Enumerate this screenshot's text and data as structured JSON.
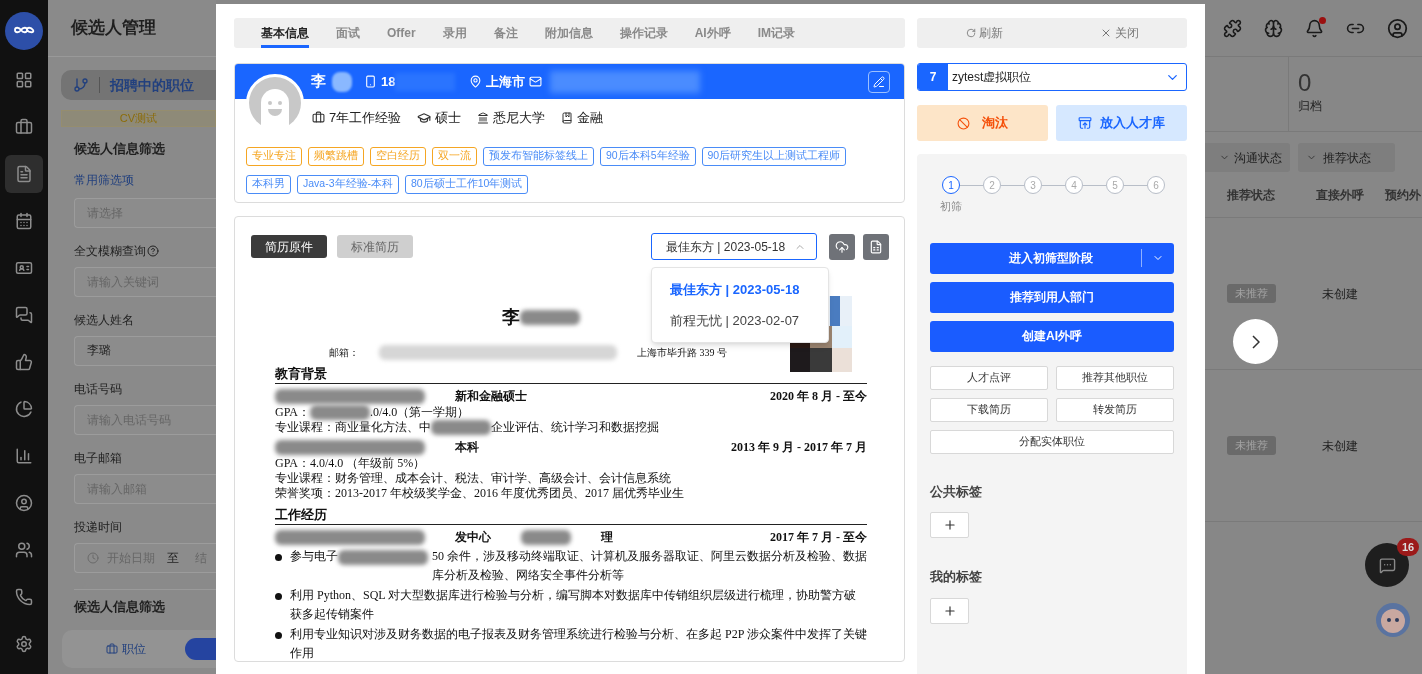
{
  "sidebar": {
    "items": [
      {
        "selected": false
      },
      {
        "selected": false
      },
      {
        "selected": true
      },
      {
        "selected": false
      },
      {
        "selected": false
      },
      {
        "selected": false
      },
      {
        "selected": false
      },
      {
        "selected": false
      },
      {
        "selected": false
      },
      {
        "selected": false
      },
      {
        "selected": false
      },
      {
        "selected": false
      },
      {
        "selected": false
      }
    ]
  },
  "page": {
    "title": "候选人管理",
    "job_tab": "招聘中的职位",
    "job_name": "CV测试",
    "filter_title": "候选人信息筛选",
    "quick_filter_link": "常用筛选项",
    "fields": [
      {
        "kind": "select",
        "placeholder": "请选择"
      },
      {
        "kind": "input",
        "label": "全文模糊查询",
        "help": true,
        "placeholder": "请输入关键词"
      },
      {
        "kind": "input",
        "label": "候选人姓名",
        "help": false,
        "value": "李璐"
      },
      {
        "kind": "input",
        "label": "电话号码",
        "help": false,
        "placeholder": "请输入电话号码"
      },
      {
        "kind": "input",
        "label": "电子邮箱",
        "help": false,
        "placeholder": "请输入邮箱"
      },
      {
        "kind": "daterange",
        "label": "投递时间",
        "start_placeholder": "开始日期",
        "separator": "至",
        "end_placeholder": "结"
      }
    ],
    "second_filter_title": "候选人信息筛选",
    "bottom_button": "职位"
  },
  "background": {
    "stats": [
      {
        "value": "0",
        "label": "归档"
      }
    ],
    "filters": [
      "沟通状态",
      "推荐状态"
    ],
    "columns": [
      "推荐状态",
      "直接外呼",
      "预约外"
    ],
    "rows": [
      {
        "status": "未推荐",
        "call": "未创建"
      },
      {
        "status": "未推荐",
        "call": "未创建"
      }
    ],
    "notifications_unread": true,
    "chat_badge": "16"
  },
  "modal": {
    "tabs": [
      {
        "label": "基本信息",
        "selected": true
      },
      {
        "label": "面试",
        "selected": false
      },
      {
        "label": "Offer",
        "selected": false
      },
      {
        "label": "录用",
        "selected": false
      },
      {
        "label": "备注",
        "selected": false
      },
      {
        "label": "附加信息",
        "selected": false
      },
      {
        "label": "操作记录",
        "selected": false
      },
      {
        "label": "AI外呼",
        "selected": false
      },
      {
        "label": "IM记录",
        "selected": false
      }
    ],
    "candidate": {
      "name": "李",
      "phone": "18",
      "city": "上海市",
      "facts": [
        {
          "kind": "experience",
          "text": "7年工作经验"
        },
        {
          "kind": "degree",
          "text": "硕士"
        },
        {
          "kind": "school",
          "text": "悉尼大学"
        },
        {
          "kind": "industry",
          "text": "金融"
        }
      ],
      "tags": [
        {
          "text": "专业专注",
          "color": "#f5a623"
        },
        {
          "text": "频繁跳槽",
          "color": "#f5a623"
        },
        {
          "text": "空白经历",
          "color": "#f5a623"
        },
        {
          "text": "双一流",
          "color": "#f5a623"
        },
        {
          "text": "预发布智能标签线上",
          "color": "#4a8cf7"
        },
        {
          "text": "90后本科5年经验",
          "color": "#4a8cf7"
        },
        {
          "text": "90后研究生以上测试工程师",
          "color": "#4a8cf7"
        },
        {
          "text": "本科男",
          "color": "#4a8cf7"
        },
        {
          "text": "Java-3年经验-本科",
          "color": "#4a8cf7"
        },
        {
          "text": "80后硕士工作10年测试",
          "color": "#4a8cf7"
        }
      ]
    },
    "resume": {
      "views": [
        {
          "label": "简历原件",
          "selected": true
        },
        {
          "label": "标准简历",
          "selected": false
        }
      ],
      "source_select": {
        "value": "最佳东方 | 2023-05-18",
        "expanded": true
      },
      "source_options": [
        {
          "label": "最佳东方 | 2023-05-18",
          "selected": true
        },
        {
          "label": "前程无忧 | 2023-02-07",
          "selected": false
        }
      ],
      "document": [
        {
          "kind": "name",
          "parts": [
            {
              "kind": "text",
              "text": "李"
            },
            {
              "kind": "redacted"
            }
          ]
        },
        {
          "kind": "contact",
          "parts": [
            {
              "kind": "text",
              "text": "邮箱："
            },
            {
              "kind": "redacted"
            },
            {
              "kind": "text",
              "text": "上海市毕升路 339 号"
            }
          ]
        },
        {
          "kind": "section",
          "parts": [
            {
              "kind": "text",
              "text": "教育背景"
            }
          ]
        },
        {
          "kind": "row",
          "parts": [
            {
              "kind": "redacted"
            },
            {
              "kind": "text",
              "text": "新和金融硕士"
            }
          ],
          "right": "2020 年 8 月 - 至今"
        },
        {
          "kind": "text",
          "parts": [
            {
              "kind": "text",
              "text": "GPA："
            },
            {
              "kind": "redacted"
            },
            {
              "kind": "text",
              "text": ".0/4.0（第一学期）"
            }
          ]
        },
        {
          "kind": "text",
          "parts": [
            {
              "kind": "text",
              "text": "专业课程：商业量化方法、中"
            },
            {
              "kind": "redacted"
            },
            {
              "kind": "text",
              "text": "企业评估、统计学习和数据挖掘"
            }
          ]
        },
        {
          "kind": "row",
          "parts": [
            {
              "kind": "redacted"
            },
            {
              "kind": "text",
              "text": "本科"
            }
          ],
          "right": "2013 年 9 月 - 2017 年 7 月"
        },
        {
          "kind": "text",
          "parts": [
            {
              "kind": "text",
              "text": "GPA：4.0/4.0 （年级前 5%）"
            }
          ]
        },
        {
          "kind": "text",
          "parts": [
            {
              "kind": "text",
              "text": "专业课程：财务管理、成本会计、税法、审计学、高级会计、会计信息系统"
            }
          ]
        },
        {
          "kind": "text",
          "parts": [
            {
              "kind": "text",
              "text": "荣誉奖项：2013-2017 年校级奖学金、2016 年度优秀团员、2017 届优秀毕业生"
            }
          ]
        },
        {
          "kind": "section",
          "parts": [
            {
              "kind": "text",
              "text": "工作经历"
            }
          ]
        },
        {
          "kind": "row",
          "parts": [
            {
              "kind": "redacted"
            },
            {
              "kind": "text",
              "text": "发中心"
            },
            {
              "kind": "redacted"
            },
            {
              "kind": "text",
              "text": "理"
            }
          ],
          "right": "2017 年 7 月 - 至今"
        },
        {
          "kind": "bullet",
          "parts": [
            {
              "kind": "text",
              "text": "参与电子"
            },
            {
              "kind": "redacted"
            },
            {
              "kind": "text",
              "text": "50 余件，涉及移动终端取证、计算机及服务器取证、阿里云数据分析及检验、数据库分析及检验、网络安全事件分析等"
            }
          ]
        },
        {
          "kind": "bullet",
          "parts": [
            {
              "kind": "text",
              "text": "利用 Python、SQL 对大型数据库进行检验与分析，编写脚本对数据库中传销组织层级进行梳理，协助警方破获多起传销案件"
            }
          ]
        },
        {
          "kind": "bullet",
          "parts": [
            {
              "kind": "text",
              "text": "利用专业知识对涉及财务数据的电子报表及财务管理系统进行检验与分析、在多起 P2P 涉众案件中发挥了关键作用"
            }
          ]
        }
      ]
    },
    "side": {
      "actions": [
        {
          "kind": "refresh",
          "label": "刷新"
        },
        {
          "kind": "close",
          "label": "关闭"
        }
      ],
      "position": {
        "number": "7",
        "name": "zytest虚拟职位"
      },
      "reject": "淘汰",
      "talent_pool": "放入人才库",
      "steps": [
        {
          "number": "1",
          "label": "初筛",
          "selected": true
        },
        {
          "number": "2",
          "selected": false
        },
        {
          "number": "3",
          "selected": false
        },
        {
          "number": "4",
          "selected": false
        },
        {
          "number": "5",
          "selected": false
        },
        {
          "number": "6",
          "selected": false
        }
      ],
      "primary_buttons": [
        {
          "kind": "split",
          "label": "进入初筛型阶段"
        },
        {
          "kind": "plain",
          "label": "推荐到用人部门"
        },
        {
          "kind": "plain",
          "label": "创建AI外呼"
        }
      ],
      "secondary_buttons": [
        {
          "label": "人才点评",
          "wide": false
        },
        {
          "label": "推荐其他职位",
          "wide": false
        },
        {
          "label": "下载简历",
          "wide": false
        },
        {
          "label": "转发简历",
          "wide": false
        },
        {
          "label": "分配实体职位",
          "wide": true
        }
      ],
      "tag_groups": [
        "公共标签",
        "我的标签"
      ]
    }
  }
}
